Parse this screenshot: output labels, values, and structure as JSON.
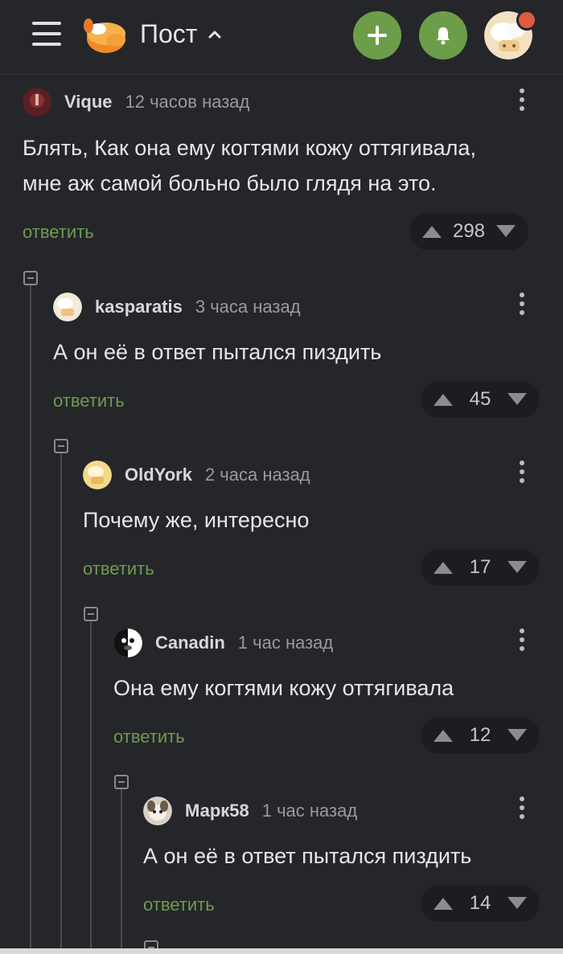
{
  "header": {
    "title": "Пост",
    "add_icon": "plus-icon",
    "bell_icon": "bell-icon",
    "menu_icon": "hamburger-icon",
    "accent_color": "#6c9e4a"
  },
  "comments": [
    {
      "user": "Vique",
      "time": "12 часов назад",
      "text_lines": [
        "Блять, Как она ему когтями кожу оттягивала,",
        "мне аж самой больно было глядя на это."
      ],
      "reply": "ответить",
      "rating": "298"
    },
    {
      "user": "kasparatis",
      "time": "3 часа назад",
      "text_lines": [
        "А он её в ответ пытался пиздить"
      ],
      "reply": "ответить",
      "rating": "45"
    },
    {
      "user": "OldYork",
      "time": "2 часа назад",
      "text_lines": [
        "Почему же, интересно"
      ],
      "reply": "ответить",
      "rating": "17"
    },
    {
      "user": "Canadin",
      "time": "1 час назад",
      "text_lines": [
        "Она ему когтями кожу оттягивала"
      ],
      "reply": "ответить",
      "rating": "12"
    },
    {
      "user": "Марк58",
      "time": "1 час назад",
      "text_lines": [
        "А он её в ответ пытался пиздить"
      ],
      "reply": "ответить",
      "rating": "14"
    }
  ]
}
